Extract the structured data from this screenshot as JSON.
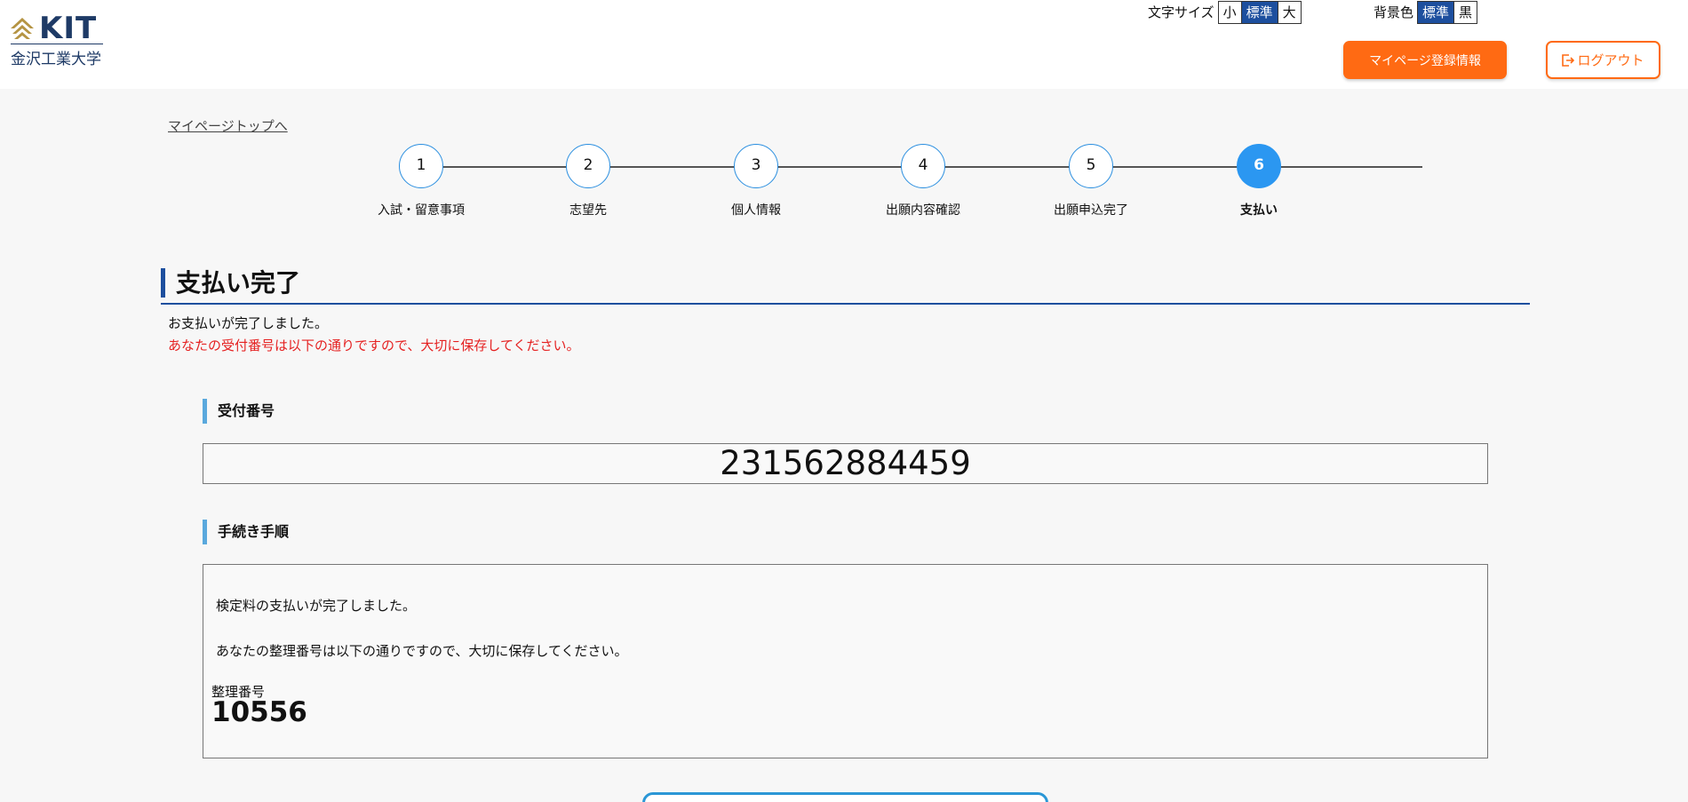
{
  "header": {
    "logo_text": "KIT",
    "logo_subtitle": "金沢工業大学",
    "font_size_label": "文字サイズ",
    "font_size_options": [
      "小",
      "標準",
      "大"
    ],
    "font_size_selected": "標準",
    "bg_color_label": "背景色",
    "bg_color_options": [
      "標準",
      "黒"
    ],
    "bg_color_selected": "標準",
    "mypage_button": "マイページ登録情報",
    "logout_button": "ログアウト"
  },
  "back_link": "マイページトップへ",
  "steps": [
    {
      "number": "1",
      "label": "入試・留意事項"
    },
    {
      "number": "2",
      "label": "志望先"
    },
    {
      "number": "3",
      "label": "個人情報"
    },
    {
      "number": "4",
      "label": "出願内容確認"
    },
    {
      "number": "5",
      "label": "出願申込完了"
    },
    {
      "number": "6",
      "label": "支払い"
    }
  ],
  "active_step": "6",
  "main": {
    "title": "支払い完了",
    "message": "お支払いが完了しました。",
    "warning": "あなたの受付番号は以下の通りですので、大切に保存してください。",
    "receipt_heading": "受付番号",
    "receipt_number": "231562884459",
    "procedure_heading": "手続き手順",
    "procedure_line1": "検定料の支払いが完了しました。",
    "procedure_line2": "あなたの整理番号は以下の通りですので、大切に保存してください。",
    "reference_label": "整理番号",
    "reference_number": "10556"
  },
  "colors": {
    "accent_orange": "#ff6a13",
    "primary_blue": "#1d4f9e",
    "step_active": "#2b97f1",
    "warning_red": "#e52121"
  }
}
